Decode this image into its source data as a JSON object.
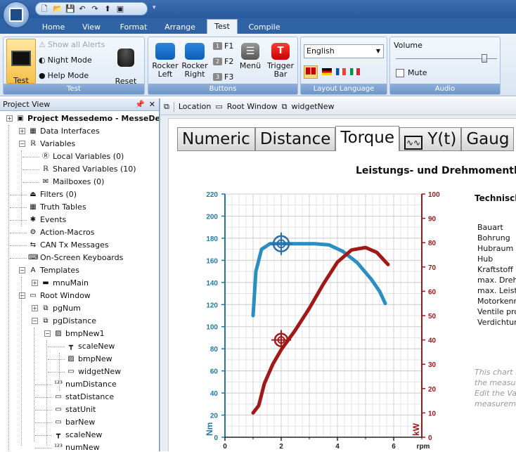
{
  "ribbon": {
    "tabs": [
      "Home",
      "View",
      "Format",
      "Arrange",
      "Test",
      "Compile"
    ],
    "active_tab": "Test",
    "groups": {
      "test": {
        "label": "Test",
        "test_mode": "Test\nMode",
        "show_alerts": "Show all Alerts",
        "night_mode": "Night Mode",
        "help_mode": "Help Mode",
        "reset_variables": "Reset\nVariables"
      },
      "buttons": {
        "label": "Buttons",
        "rocker_left": "Rocker\nLeft",
        "rocker_right": "Rocker\nRight",
        "f1": "F1",
        "f2": "F2",
        "f3": "F3",
        "f1_num": "1",
        "f2_num": "2",
        "f3_num": "3",
        "menu": "Menü",
        "trigger_bar": "Trigger\nBar"
      },
      "layout_language": {
        "label": "Layout Language",
        "selected": "English"
      },
      "audio": {
        "label": "Audio",
        "volume_label": "Volume",
        "volume_level": 0.9,
        "mute_label": "Mute"
      }
    }
  },
  "project_view": {
    "title": "Project View",
    "items": [
      "Project Messedemo - MesseDem",
      "Data Interfaces",
      "Variables",
      "Local Variables (0)",
      "Shared Variables (10)",
      "Mailboxes (0)",
      "Filters (0)",
      "Truth Tables",
      "Events",
      "Action-Macros",
      "CAN Tx Messages",
      "On-Screen Keyboards",
      "Templates",
      "mnuMain",
      "Root Window",
      "pgNum",
      "pgDistance",
      "bmpNew1",
      "scaleNew",
      "bmpNew",
      "widgetNew",
      "numDistance",
      "statDistance",
      "statUnit",
      "barNew",
      "scaleNew",
      "numNew"
    ]
  },
  "breadcrumb": {
    "location": "Location",
    "root": "Root Window",
    "widget": "widgetNew"
  },
  "widget_tabs": [
    "Numeric",
    "Distance",
    "Torque",
    "Y(t)",
    "Gaug"
  ],
  "active_widget_tab": "Torque",
  "chart_title": "Leistungs- und Drehmomentk",
  "tech": {
    "title": "Technisch",
    "rows": [
      "Bauart",
      "Bohrung",
      "Hubraum",
      "Hub",
      "Kraftstoff",
      "max. Dreh",
      "max. Leist",
      "Motorkenn",
      "Ventile pro",
      "Verdichtun"
    ],
    "notes": [
      "This chart s",
      "the measu",
      "Edit the Va",
      "measurem"
    ]
  },
  "chart_data": {
    "type": "line",
    "x_ticks": [
      "0",
      "2",
      "4",
      "6"
    ],
    "x_unit": "rpm",
    "xlim": [
      0,
      7
    ],
    "y_left": {
      "label": "Nm",
      "lim": [
        0,
        220
      ],
      "ticks": [
        "0",
        "20",
        "40",
        "60",
        "80",
        "100",
        "120",
        "140",
        "160",
        "180",
        "200",
        "220"
      ],
      "color": "#1f7aa8"
    },
    "y_right": {
      "label": "kW",
      "lim": [
        0,
        100
      ],
      "ticks": [
        "0",
        "10",
        "20",
        "30",
        "40",
        "50",
        "60",
        "70",
        "80",
        "90",
        "100"
      ],
      "color": "#a01818"
    },
    "series": [
      {
        "axis": "left",
        "color": "#2a8fc0",
        "points": [
          [
            1.0,
            110
          ],
          [
            1.1,
            150
          ],
          [
            1.3,
            170
          ],
          [
            1.6,
            175
          ],
          [
            2.0,
            175
          ],
          [
            2.6,
            175
          ],
          [
            3.2,
            175
          ],
          [
            3.7,
            174
          ],
          [
            4.2,
            168
          ],
          [
            4.7,
            158
          ],
          [
            5.2,
            143
          ],
          [
            5.5,
            132
          ],
          [
            5.7,
            121
          ]
        ]
      },
      {
        "axis": "right",
        "color": "#a01818",
        "points": [
          [
            1.0,
            10
          ],
          [
            1.2,
            13
          ],
          [
            1.4,
            22
          ],
          [
            1.7,
            30
          ],
          [
            2.0,
            36
          ],
          [
            2.5,
            44
          ],
          [
            3.0,
            53
          ],
          [
            3.5,
            63
          ],
          [
            4.0,
            72
          ],
          [
            4.5,
            77
          ],
          [
            5.0,
            78
          ],
          [
            5.4,
            76
          ],
          [
            5.8,
            71
          ]
        ]
      }
    ],
    "markers": [
      {
        "axis": "left",
        "x": 2.0,
        "y": 175
      },
      {
        "axis": "right",
        "x": 2.0,
        "y": 40
      }
    ]
  }
}
